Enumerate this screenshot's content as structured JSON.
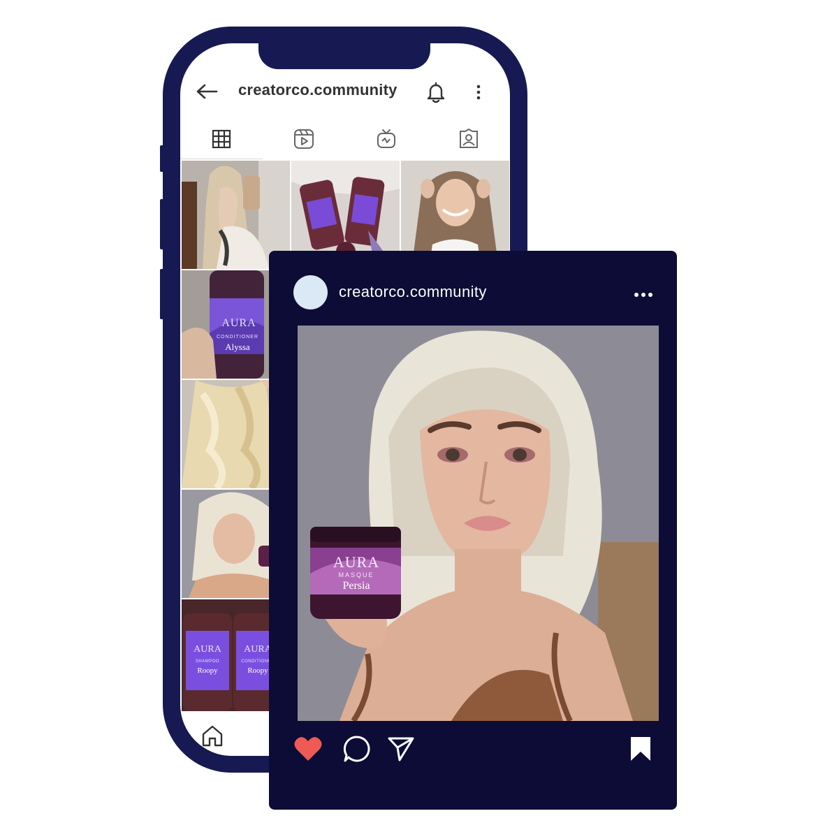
{
  "phone": {
    "header": {
      "back_icon": "arrow-left-icon",
      "username": "creatorco.community",
      "bell_icon": "bell-icon",
      "menu_icon": "vertical-dots-icon"
    },
    "tabs": [
      {
        "name": "grid",
        "icon": "grid-icon",
        "active": true
      },
      {
        "name": "reels",
        "icon": "reels-icon"
      },
      {
        "name": "igtv",
        "icon": "igtv-icon"
      },
      {
        "name": "tagged",
        "icon": "tagged-icon"
      }
    ],
    "grid_tiles": [
      {
        "alt": "woman taking mirror selfie"
      },
      {
        "alt": "hair product bottles flat lay"
      },
      {
        "alt": "smiling woman touching hair"
      },
      {
        "alt": "AURA conditioner bottle",
        "brand": "AURA",
        "type": "CONDITIONER",
        "product": "Alyssa"
      },
      {
        "alt": "wavy blonde hair"
      },
      {
        "alt": "blonde woman selfie"
      },
      {
        "alt": "AURA shampoo and conditioner",
        "brand": "AURA",
        "type1": "SHAMPOO",
        "type2": "CONDITIONER",
        "product": "Roopy"
      }
    ],
    "bottom_nav": {
      "home_icon": "home-icon"
    }
  },
  "post": {
    "username": "creatorco.community",
    "more_icon": "horizontal-dots-icon",
    "photo": {
      "alt": "blonde woman holding AURA Masque Persia jar",
      "brand": "AURA",
      "type": "MASQUE",
      "product": "Persia"
    },
    "actions": {
      "like_icon": "heart-icon",
      "comment_icon": "comment-icon",
      "share_icon": "send-icon",
      "save_icon": "bookmark-icon"
    }
  },
  "colors": {
    "phone_frame": "#171a52",
    "card_bg": "#0c0c36",
    "like": "#f05a55",
    "avatar": "#dbe8f5"
  }
}
